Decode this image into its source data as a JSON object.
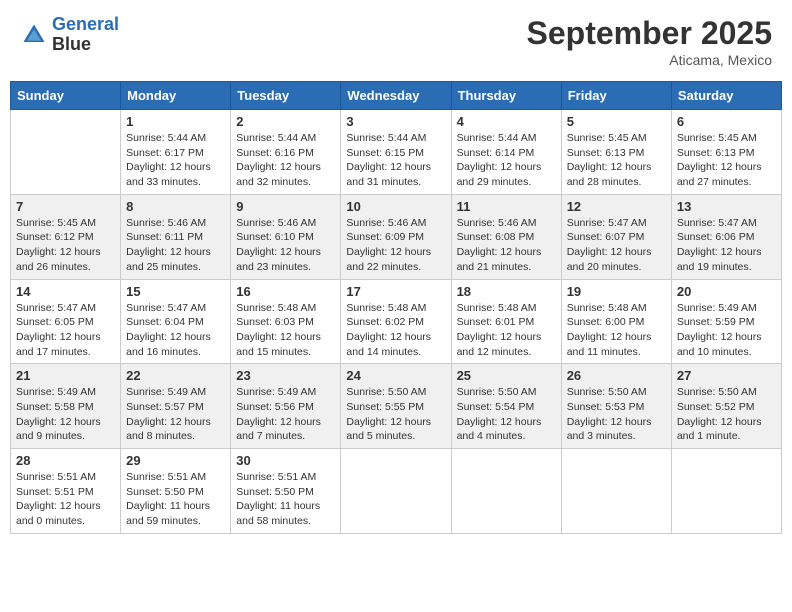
{
  "header": {
    "logo_line1": "General",
    "logo_line2": "Blue",
    "month": "September 2025",
    "location": "Aticama, Mexico"
  },
  "days_of_week": [
    "Sunday",
    "Monday",
    "Tuesday",
    "Wednesday",
    "Thursday",
    "Friday",
    "Saturday"
  ],
  "weeks": [
    [
      {
        "day": "",
        "info": ""
      },
      {
        "day": "1",
        "info": "Sunrise: 5:44 AM\nSunset: 6:17 PM\nDaylight: 12 hours\nand 33 minutes."
      },
      {
        "day": "2",
        "info": "Sunrise: 5:44 AM\nSunset: 6:16 PM\nDaylight: 12 hours\nand 32 minutes."
      },
      {
        "day": "3",
        "info": "Sunrise: 5:44 AM\nSunset: 6:15 PM\nDaylight: 12 hours\nand 31 minutes."
      },
      {
        "day": "4",
        "info": "Sunrise: 5:44 AM\nSunset: 6:14 PM\nDaylight: 12 hours\nand 29 minutes."
      },
      {
        "day": "5",
        "info": "Sunrise: 5:45 AM\nSunset: 6:13 PM\nDaylight: 12 hours\nand 28 minutes."
      },
      {
        "day": "6",
        "info": "Sunrise: 5:45 AM\nSunset: 6:13 PM\nDaylight: 12 hours\nand 27 minutes."
      }
    ],
    [
      {
        "day": "7",
        "info": "Sunrise: 5:45 AM\nSunset: 6:12 PM\nDaylight: 12 hours\nand 26 minutes."
      },
      {
        "day": "8",
        "info": "Sunrise: 5:46 AM\nSunset: 6:11 PM\nDaylight: 12 hours\nand 25 minutes."
      },
      {
        "day": "9",
        "info": "Sunrise: 5:46 AM\nSunset: 6:10 PM\nDaylight: 12 hours\nand 23 minutes."
      },
      {
        "day": "10",
        "info": "Sunrise: 5:46 AM\nSunset: 6:09 PM\nDaylight: 12 hours\nand 22 minutes."
      },
      {
        "day": "11",
        "info": "Sunrise: 5:46 AM\nSunset: 6:08 PM\nDaylight: 12 hours\nand 21 minutes."
      },
      {
        "day": "12",
        "info": "Sunrise: 5:47 AM\nSunset: 6:07 PM\nDaylight: 12 hours\nand 20 minutes."
      },
      {
        "day": "13",
        "info": "Sunrise: 5:47 AM\nSunset: 6:06 PM\nDaylight: 12 hours\nand 19 minutes."
      }
    ],
    [
      {
        "day": "14",
        "info": "Sunrise: 5:47 AM\nSunset: 6:05 PM\nDaylight: 12 hours\nand 17 minutes."
      },
      {
        "day": "15",
        "info": "Sunrise: 5:47 AM\nSunset: 6:04 PM\nDaylight: 12 hours\nand 16 minutes."
      },
      {
        "day": "16",
        "info": "Sunrise: 5:48 AM\nSunset: 6:03 PM\nDaylight: 12 hours\nand 15 minutes."
      },
      {
        "day": "17",
        "info": "Sunrise: 5:48 AM\nSunset: 6:02 PM\nDaylight: 12 hours\nand 14 minutes."
      },
      {
        "day": "18",
        "info": "Sunrise: 5:48 AM\nSunset: 6:01 PM\nDaylight: 12 hours\nand 12 minutes."
      },
      {
        "day": "19",
        "info": "Sunrise: 5:48 AM\nSunset: 6:00 PM\nDaylight: 12 hours\nand 11 minutes."
      },
      {
        "day": "20",
        "info": "Sunrise: 5:49 AM\nSunset: 5:59 PM\nDaylight: 12 hours\nand 10 minutes."
      }
    ],
    [
      {
        "day": "21",
        "info": "Sunrise: 5:49 AM\nSunset: 5:58 PM\nDaylight: 12 hours\nand 9 minutes."
      },
      {
        "day": "22",
        "info": "Sunrise: 5:49 AM\nSunset: 5:57 PM\nDaylight: 12 hours\nand 8 minutes."
      },
      {
        "day": "23",
        "info": "Sunrise: 5:49 AM\nSunset: 5:56 PM\nDaylight: 12 hours\nand 7 minutes."
      },
      {
        "day": "24",
        "info": "Sunrise: 5:50 AM\nSunset: 5:55 PM\nDaylight: 12 hours\nand 5 minutes."
      },
      {
        "day": "25",
        "info": "Sunrise: 5:50 AM\nSunset: 5:54 PM\nDaylight: 12 hours\nand 4 minutes."
      },
      {
        "day": "26",
        "info": "Sunrise: 5:50 AM\nSunset: 5:53 PM\nDaylight: 12 hours\nand 3 minutes."
      },
      {
        "day": "27",
        "info": "Sunrise: 5:50 AM\nSunset: 5:52 PM\nDaylight: 12 hours\nand 1 minute."
      }
    ],
    [
      {
        "day": "28",
        "info": "Sunrise: 5:51 AM\nSunset: 5:51 PM\nDaylight: 12 hours\nand 0 minutes."
      },
      {
        "day": "29",
        "info": "Sunrise: 5:51 AM\nSunset: 5:50 PM\nDaylight: 11 hours\nand 59 minutes."
      },
      {
        "day": "30",
        "info": "Sunrise: 5:51 AM\nSunset: 5:50 PM\nDaylight: 11 hours\nand 58 minutes."
      },
      {
        "day": "",
        "info": ""
      },
      {
        "day": "",
        "info": ""
      },
      {
        "day": "",
        "info": ""
      },
      {
        "day": "",
        "info": ""
      }
    ]
  ]
}
